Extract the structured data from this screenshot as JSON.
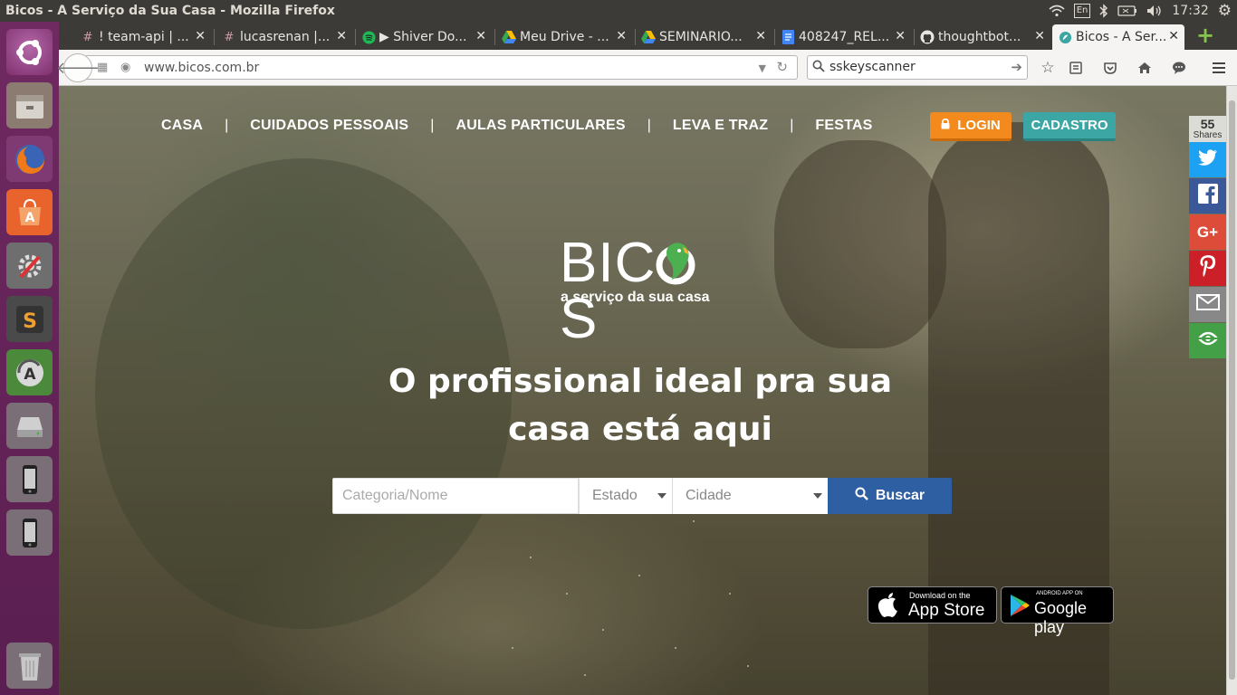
{
  "system": {
    "window_title": "Bicos - A Serviço da Sua Casa - Mozilla Firefox",
    "keyboard_layout": "En",
    "clock": "17:32"
  },
  "launcher": {
    "items": [
      {
        "name": "ubuntu-dash-icon"
      },
      {
        "name": "files-icon"
      },
      {
        "name": "firefox-icon"
      },
      {
        "name": "software-center-icon"
      },
      {
        "name": "system-settings-icon"
      },
      {
        "name": "sublime-text-icon"
      },
      {
        "name": "software-updater-icon"
      },
      {
        "name": "disk-drive-icon"
      },
      {
        "name": "phone-device-icon"
      },
      {
        "name": "phone-device-icon"
      },
      {
        "name": "trash-icon"
      }
    ]
  },
  "browser": {
    "tabs": [
      {
        "label": "! team-api | ...",
        "icon": "slack-icon"
      },
      {
        "label": "lucasrenan |...",
        "icon": "slack-icon"
      },
      {
        "label": "▶ Shiver Do...",
        "icon": "spotify-icon"
      },
      {
        "label": "Meu Drive - ...",
        "icon": "google-drive-icon"
      },
      {
        "label": "SEMINARIO...",
        "icon": "google-drive-icon"
      },
      {
        "label": "408247_REL...",
        "icon": "google-docs-icon"
      },
      {
        "label": "thoughtbot...",
        "icon": "github-icon"
      },
      {
        "label": "Bicos - A Ser...",
        "icon": "bicos-favicon-icon",
        "active": true
      }
    ],
    "url": "www.bicos.com.br",
    "search_value": "sskeyscanner"
  },
  "site": {
    "nav": [
      "CASA",
      "CUIDADOS PESSOAIS",
      "AULAS PARTICULARES",
      "LEVA E TRAZ",
      "FESTAS"
    ],
    "nav_separator": "|",
    "login_label": "LOGIN",
    "signup_label": "CADASTRO",
    "logo_text_before": "BIC",
    "logo_text_after": "S",
    "tagline": "a serviço da sua casa",
    "headline_line1": "O profissional ideal pra sua",
    "headline_line2": "casa está aqui",
    "search": {
      "category_placeholder": "Categoria/Nome",
      "state_label": "Estado",
      "city_label": "Cidade",
      "button_label": "Buscar"
    },
    "app_store": {
      "small": "Download on the",
      "big": "App Store"
    },
    "google_play": {
      "small": "ANDROID APP ON",
      "big": "Google play"
    },
    "colors": {
      "login": "#f28a1e",
      "signup": "#3ba6a3",
      "search_button": "#2f5fa3"
    }
  },
  "share": {
    "count": "55",
    "label": "Shares",
    "buttons": [
      {
        "name": "twitter-share-button",
        "color": "#1da1f2"
      },
      {
        "name": "facebook-share-button",
        "color": "#3b5998"
      },
      {
        "name": "google-plus-share-button",
        "color": "#dd4b39"
      },
      {
        "name": "pinterest-share-button",
        "color": "#cb2027"
      },
      {
        "name": "email-share-button",
        "color": "#888888"
      },
      {
        "name": "more-share-button",
        "color": "#43a047"
      }
    ]
  }
}
